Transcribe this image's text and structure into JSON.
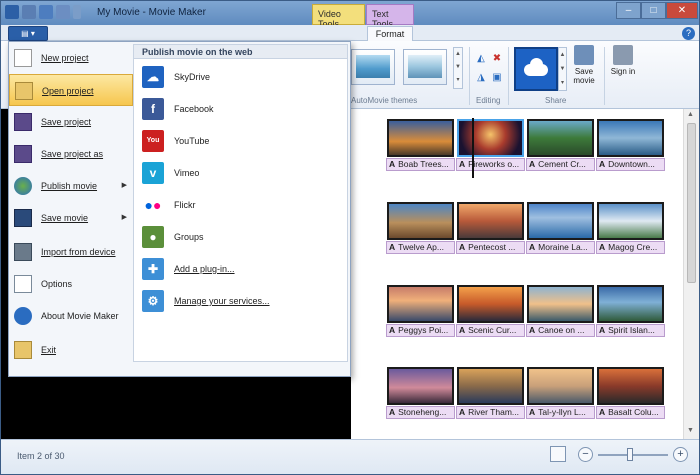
{
  "window": {
    "title": "My Movie - Movie Maker",
    "context_tabs": [
      "Video Tools",
      "Text Tools"
    ],
    "controls": {
      "minimize": "–",
      "maximize": "□",
      "close": "✕"
    }
  },
  "ribbon": {
    "active_tab": "Format",
    "groups": {
      "themes": "AutoMovie themes",
      "editing": "Editing",
      "sharing": "Share"
    },
    "save_movie": "Save movie",
    "sign_in": "Sign in"
  },
  "app_menu": {
    "items": [
      {
        "label": "New project",
        "icon": "new-project-icon"
      },
      {
        "label": "Open project",
        "icon": "open-project-icon"
      },
      {
        "label": "Save project",
        "icon": "save-project-icon"
      },
      {
        "label": "Save project as",
        "icon": "save-as-icon"
      },
      {
        "label": "Publish movie",
        "icon": "globe-icon",
        "has_submenu": true
      },
      {
        "label": "Save movie",
        "icon": "film-icon",
        "has_submenu": true
      },
      {
        "label": "Import from device",
        "icon": "camera-icon"
      },
      {
        "label": "Options",
        "icon": "options-icon"
      },
      {
        "label": "About Movie Maker",
        "icon": "info-icon"
      },
      {
        "label": "Exit",
        "icon": "exit-icon"
      }
    ],
    "publish": {
      "heading": "Publish movie on the web",
      "services": [
        {
          "label": "SkyDrive",
          "icon": "skydrive-icon",
          "color": "#1f63c0"
        },
        {
          "label": "Facebook",
          "icon": "facebook-icon",
          "color": "#3b5998"
        },
        {
          "label": "YouTube",
          "icon": "youtube-icon",
          "color": "#cc2020"
        },
        {
          "label": "Vimeo",
          "icon": "vimeo-icon",
          "color": "#1aa3d6"
        },
        {
          "label": "Flickr",
          "icon": "flickr-icon",
          "color": "#ffffff"
        },
        {
          "label": "Groups",
          "icon": "groups-icon",
          "color": "#5b8f3a"
        },
        {
          "label": "Add a plug-in...",
          "icon": "puzzle-icon",
          "color": "#3d8fd6"
        },
        {
          "label": "Manage your services...",
          "icon": "services-icon",
          "color": "#3d8fd6"
        }
      ]
    }
  },
  "timeline": {
    "clips": [
      "Boab Trees...",
      "Fireworks o...",
      "Cement Cr...",
      "Downtown...",
      "Twelve Ap...",
      "Pentecost ...",
      "Moraine La...",
      "Magog Cre...",
      "Peggys Poi...",
      "Scenic Cur...",
      "Canoe on ...",
      "Spirit Islan...",
      "Stoneheng...",
      "River Tham...",
      "Tal-y-llyn L...",
      "Basalt Colu..."
    ],
    "caption_marker": "A"
  },
  "status": {
    "text": "Item 2 of 30",
    "zoom_out": "−",
    "zoom_in": "+",
    "zoom_level": 0.45
  }
}
